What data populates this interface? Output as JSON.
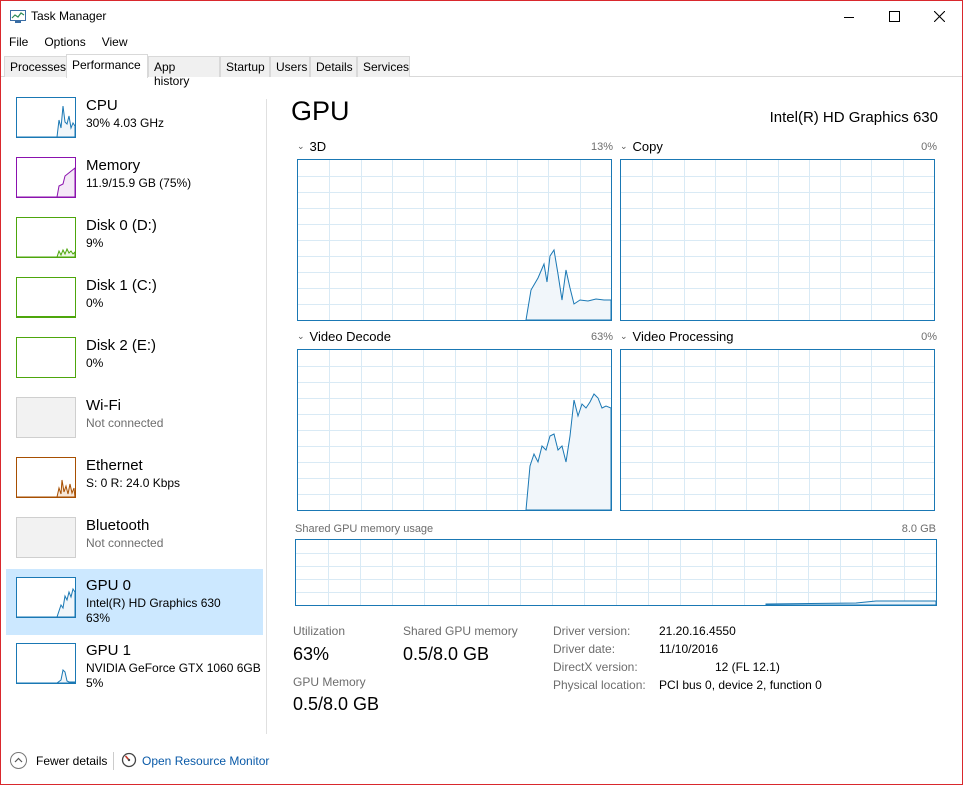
{
  "window": {
    "title": "Task Manager"
  },
  "menu": [
    "File",
    "Options",
    "View"
  ],
  "tabs": [
    {
      "label": "Processes",
      "active": false
    },
    {
      "label": "Performance",
      "active": true
    },
    {
      "label": "App history",
      "active": false
    },
    {
      "label": "Startup",
      "active": false
    },
    {
      "label": "Users",
      "active": false
    },
    {
      "label": "Details",
      "active": false
    },
    {
      "label": "Services",
      "active": false
    }
  ],
  "sidebar": [
    {
      "title": "CPU",
      "line1": "30%  4.03 GHz",
      "line2": "",
      "color": "#1a78b4",
      "selected": false
    },
    {
      "title": "Memory",
      "line1": "11.9/15.9 GB (75%)",
      "line2": "",
      "color": "#8b12ae",
      "selected": false
    },
    {
      "title": "Disk 0 (D:)",
      "line1": "9%",
      "line2": "",
      "color": "#4da60c",
      "selected": false
    },
    {
      "title": "Disk 1 (C:)",
      "line1": "0%",
      "line2": "",
      "color": "#4da60c",
      "selected": false
    },
    {
      "title": "Disk 2 (E:)",
      "line1": "0%",
      "line2": "",
      "color": "#4da60c",
      "selected": false
    },
    {
      "title": "Wi-Fi",
      "line1": "Not connected",
      "line2": "",
      "color": "#cfcfcf",
      "selected": false
    },
    {
      "title": "Ethernet",
      "line1": "S: 0  R: 24.0 Kbps",
      "line2": "",
      "color": "#a74f01",
      "selected": false
    },
    {
      "title": "Bluetooth",
      "line1": "Not connected",
      "line2": "",
      "color": "#cfcfcf",
      "selected": false
    },
    {
      "title": "GPU 0",
      "line1": "Intel(R) HD Graphics 630",
      "line2": "63%",
      "color": "#1a78b4",
      "selected": true
    },
    {
      "title": "GPU 1",
      "line1": "NVIDIA GeForce GTX 1060 6GB",
      "line2": "5%",
      "color": "#1a78b4",
      "selected": false
    }
  ],
  "main": {
    "title": "GPU",
    "device_name": "Intel(R) HD Graphics 630",
    "engines": [
      {
        "label": "3D",
        "percent": "13%"
      },
      {
        "label": "Copy",
        "percent": "0%"
      },
      {
        "label": "Video Decode",
        "percent": "63%"
      },
      {
        "label": "Video Processing",
        "percent": "0%"
      }
    ],
    "shared_memory_label": "Shared GPU memory usage",
    "shared_memory_max": "8.0 GB",
    "stats": {
      "utilization_label": "Utilization",
      "utilization_value": "63%",
      "shared_label": "Shared GPU memory",
      "shared_value": "0.5/8.0 GB",
      "gpu_memory_label": "GPU Memory",
      "gpu_memory_value": "0.5/8.0 GB"
    },
    "info": [
      {
        "key": "Driver version:",
        "value": "21.20.16.4550"
      },
      {
        "key": "Driver date:",
        "value": "11/10/2016"
      },
      {
        "key": "DirectX version:",
        "value": "12 (FL 12.1)"
      },
      {
        "key": "Physical location:",
        "value": "PCI bus 0, device 2, function 0"
      }
    ]
  },
  "footer": {
    "fewer_details": "Fewer details",
    "open_resource_monitor": "Open Resource Monitor"
  },
  "colors": {
    "accent": "#1a78b4",
    "selected_bg": "#cce8ff",
    "link": "#0a5aa8",
    "window_border": "#d9282d"
  }
}
